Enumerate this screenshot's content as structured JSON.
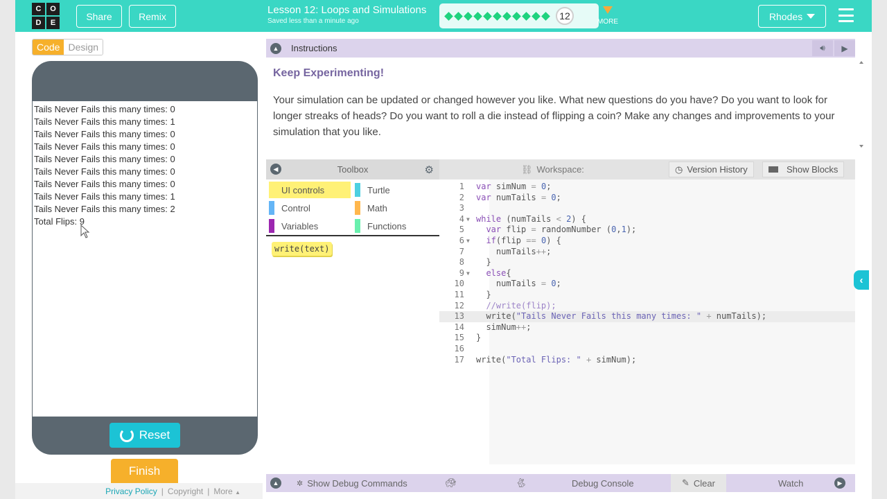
{
  "header": {
    "logo_letters": [
      "C",
      "O",
      "D",
      "E"
    ],
    "share_label": "Share",
    "remix_label": "Remix",
    "lesson_title": "Lesson 12: Loops and Simulations",
    "saved_status": "Saved less than a minute ago",
    "progress_dots": 11,
    "current_level": "12",
    "more_label": "MORE",
    "user_name": "Rhodes",
    "accent_color": "#3ad7c4"
  },
  "mode_toggle": {
    "code_label": "Code",
    "design_label": "Design"
  },
  "app_output": {
    "lines": [
      "Tails Never Fails this many times: 0",
      "Tails Never Fails this many times: 1",
      "Tails Never Fails this many times: 0",
      "Tails Never Fails this many times: 0",
      "Tails Never Fails this many times: 0",
      "Tails Never Fails this many times: 0",
      "Tails Never Fails this many times: 0",
      "Tails Never Fails this many times: 1",
      "Tails Never Fails this many times: 2",
      "Total Flips: 9"
    ]
  },
  "controls": {
    "reset_label": "Reset",
    "finish_label": "Finish"
  },
  "footer": {
    "privacy_label": "Privacy Policy",
    "copyright_label": "Copyright",
    "more_label": "More"
  },
  "instructions": {
    "header_label": "Instructions",
    "title": "Keep Experimenting!",
    "body": "Your simulation can be updated or changed however you like. What new questions do you have? Do you want to look for longer streaks of heads? Do you want to roll a die instead of flipping a coin? Make any changes and improvements to your simulation that you like."
  },
  "toolbox": {
    "label": "Toolbox",
    "categories": [
      {
        "label": "UI controls",
        "color": "#fff176",
        "selected": true
      },
      {
        "label": "Turtle",
        "color": "#4dd0e1"
      },
      {
        "label": "Control",
        "color": "#64b5f6"
      },
      {
        "label": "Math",
        "color": "#ffb74d"
      },
      {
        "label": "Variables",
        "color": "#9c27b0"
      },
      {
        "label": "Functions",
        "color": "#69f0ae"
      }
    ],
    "blocks": [
      "write(text)"
    ]
  },
  "workspace": {
    "label": "Workspace:",
    "version_history_label": "Version History",
    "show_blocks_label": "Show Blocks",
    "code_lines": [
      {
        "n": "1",
        "text": "var simNum = 0;"
      },
      {
        "n": "2",
        "text": "var numTails = 0;"
      },
      {
        "n": "3",
        "text": ""
      },
      {
        "n": "4",
        "text": "while (numTails < 2) {"
      },
      {
        "n": "5",
        "text": "  var flip = randomNumber (0,1);"
      },
      {
        "n": "6",
        "text": "  if(flip == 0) {"
      },
      {
        "n": "7",
        "text": "    numTails++;"
      },
      {
        "n": "8",
        "text": "  }"
      },
      {
        "n": "9",
        "text": "  else{"
      },
      {
        "n": "10",
        "text": "    numTails = 0;"
      },
      {
        "n": "11",
        "text": "  }"
      },
      {
        "n": "12",
        "text": "  //write(flip);"
      },
      {
        "n": "13",
        "text": "  write(\"Tails Never Fails this many times: \" + numTails);"
      },
      {
        "n": "14",
        "text": "  simNum++;"
      },
      {
        "n": "15",
        "text": "}"
      },
      {
        "n": "16",
        "text": ""
      },
      {
        "n": "17",
        "text": "write(\"Total Flips: \" + simNum);"
      }
    ]
  },
  "debug": {
    "show_commands_label": "Show Debug Commands",
    "console_label": "Debug Console",
    "clear_label": "Clear",
    "watch_label": "Watch"
  }
}
